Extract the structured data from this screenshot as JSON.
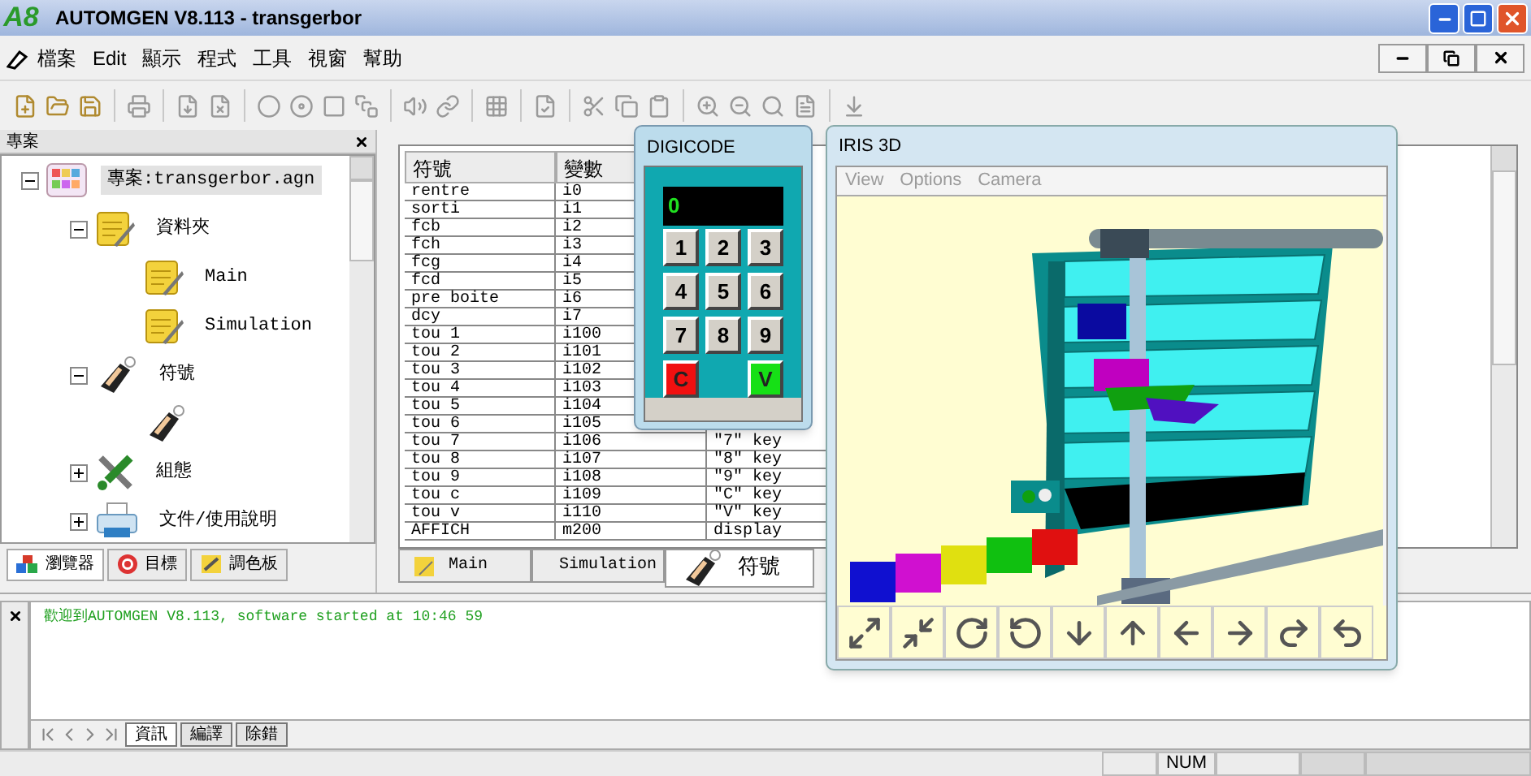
{
  "window": {
    "logo": "A8",
    "title": "AUTOMGEN V8.113 - transgerbor"
  },
  "menu": [
    "檔案",
    "Edit",
    "顯示",
    "程式",
    "工具",
    "視窗",
    "幫助"
  ],
  "project_panel": {
    "title": "專案",
    "tree": [
      {
        "label": "專案:transgerbor.agn",
        "kind": "project",
        "selected": true,
        "expanded": true,
        "children": [
          {
            "label": "資料夾",
            "kind": "folder",
            "selected": false,
            "expanded": true,
            "children": [
              {
                "label": "Main",
                "kind": "sheet",
                "selected": false
              },
              {
                "label": "Simulation",
                "kind": "sheet",
                "selected": false
              }
            ]
          },
          {
            "label": "符號",
            "kind": "tag",
            "selected": false,
            "expanded": true,
            "children": [
              {
                "kind": "tag",
                "selected": false
              }
            ]
          },
          {
            "label": "組態",
            "kind": "config",
            "selected": false,
            "expanded": false
          },
          {
            "label": "文件/使用說明",
            "kind": "docs",
            "selected": false,
            "expanded": false
          }
        ]
      }
    ],
    "tabs": [
      {
        "label": "瀏覽器",
        "kind": "browser",
        "selected": true
      },
      {
        "label": "目標",
        "kind": "target",
        "selected": false
      },
      {
        "label": "調色板",
        "kind": "palette",
        "selected": false
      }
    ]
  },
  "symbol_table": {
    "columns": [
      "符號",
      "變數"
    ],
    "rows": [
      {
        "symbol": "rentre",
        "variable": "i0"
      },
      {
        "symbol": "sorti",
        "variable": "i1"
      },
      {
        "symbol": "fcb",
        "variable": "i2"
      },
      {
        "symbol": "fch",
        "variable": "i3"
      },
      {
        "symbol": "fcg",
        "variable": "i4"
      },
      {
        "symbol": "fcd",
        "variable": "i5"
      },
      {
        "symbol": "pre boite",
        "variable": "i6"
      },
      {
        "symbol": "dcy",
        "variable": "i7"
      },
      {
        "symbol": "tou 1",
        "variable": "i100"
      },
      {
        "symbol": "tou 2",
        "variable": "i101"
      },
      {
        "symbol": "tou 3",
        "variable": "i102"
      },
      {
        "symbol": "tou 4",
        "variable": "i103"
      },
      {
        "symbol": "tou 5",
        "variable": "i104"
      },
      {
        "symbol": "tou 6",
        "variable": "i105"
      },
      {
        "symbol": "tou 7",
        "variable": "i106",
        "column_3": "\"7\" key"
      },
      {
        "symbol": "tou 8",
        "variable": "i107",
        "column_3": "\"8\" key"
      },
      {
        "symbol": "tou 9",
        "variable": "i108",
        "column_3": "\"9\" key"
      },
      {
        "symbol": "tou c",
        "variable": "i109",
        "column_3": "\"C\" key"
      },
      {
        "symbol": "tou v",
        "variable": "i110",
        "column_3": "\"V\" key"
      },
      {
        "symbol": "AFFICH",
        "variable": "m200",
        "column_3": "display"
      }
    ]
  },
  "document_tabs": [
    {
      "label": "Main",
      "selected": false
    },
    {
      "label": "Simulation",
      "selected": false
    },
    {
      "label": "符號",
      "selected": true
    }
  ],
  "digicode": {
    "title": "DIGICODE",
    "display": "0",
    "keys": [
      {
        "label": "1",
        "kind": "digit"
      },
      {
        "label": "2",
        "kind": "digit"
      },
      {
        "label": "3",
        "kind": "digit"
      },
      {
        "label": "4",
        "kind": "digit"
      },
      {
        "label": "5",
        "kind": "digit"
      },
      {
        "label": "6",
        "kind": "digit"
      },
      {
        "label": "7",
        "kind": "digit"
      },
      {
        "label": "8",
        "kind": "digit"
      },
      {
        "label": "9",
        "kind": "digit"
      },
      {
        "label": "C",
        "kind": "cancel"
      },
      {
        "label": "V",
        "kind": "validate"
      }
    ]
  },
  "iris": {
    "title": "IRIS 3D",
    "menu": [
      {
        "label": "View",
        "disabled": true
      },
      {
        "label": "Options",
        "disabled": true
      },
      {
        "label": "Camera",
        "disabled": true
      }
    ]
  },
  "messages": {
    "lines": [
      "歡迎到AUTOMGEN V8.113, software started at 10:46 59"
    ],
    "tabs": [
      {
        "label": "資訊",
        "selected": true
      },
      {
        "label": "編譯",
        "selected": false
      },
      {
        "label": "除錯",
        "selected": false
      }
    ]
  },
  "status_bar": {
    "indicator": "NUM"
  }
}
